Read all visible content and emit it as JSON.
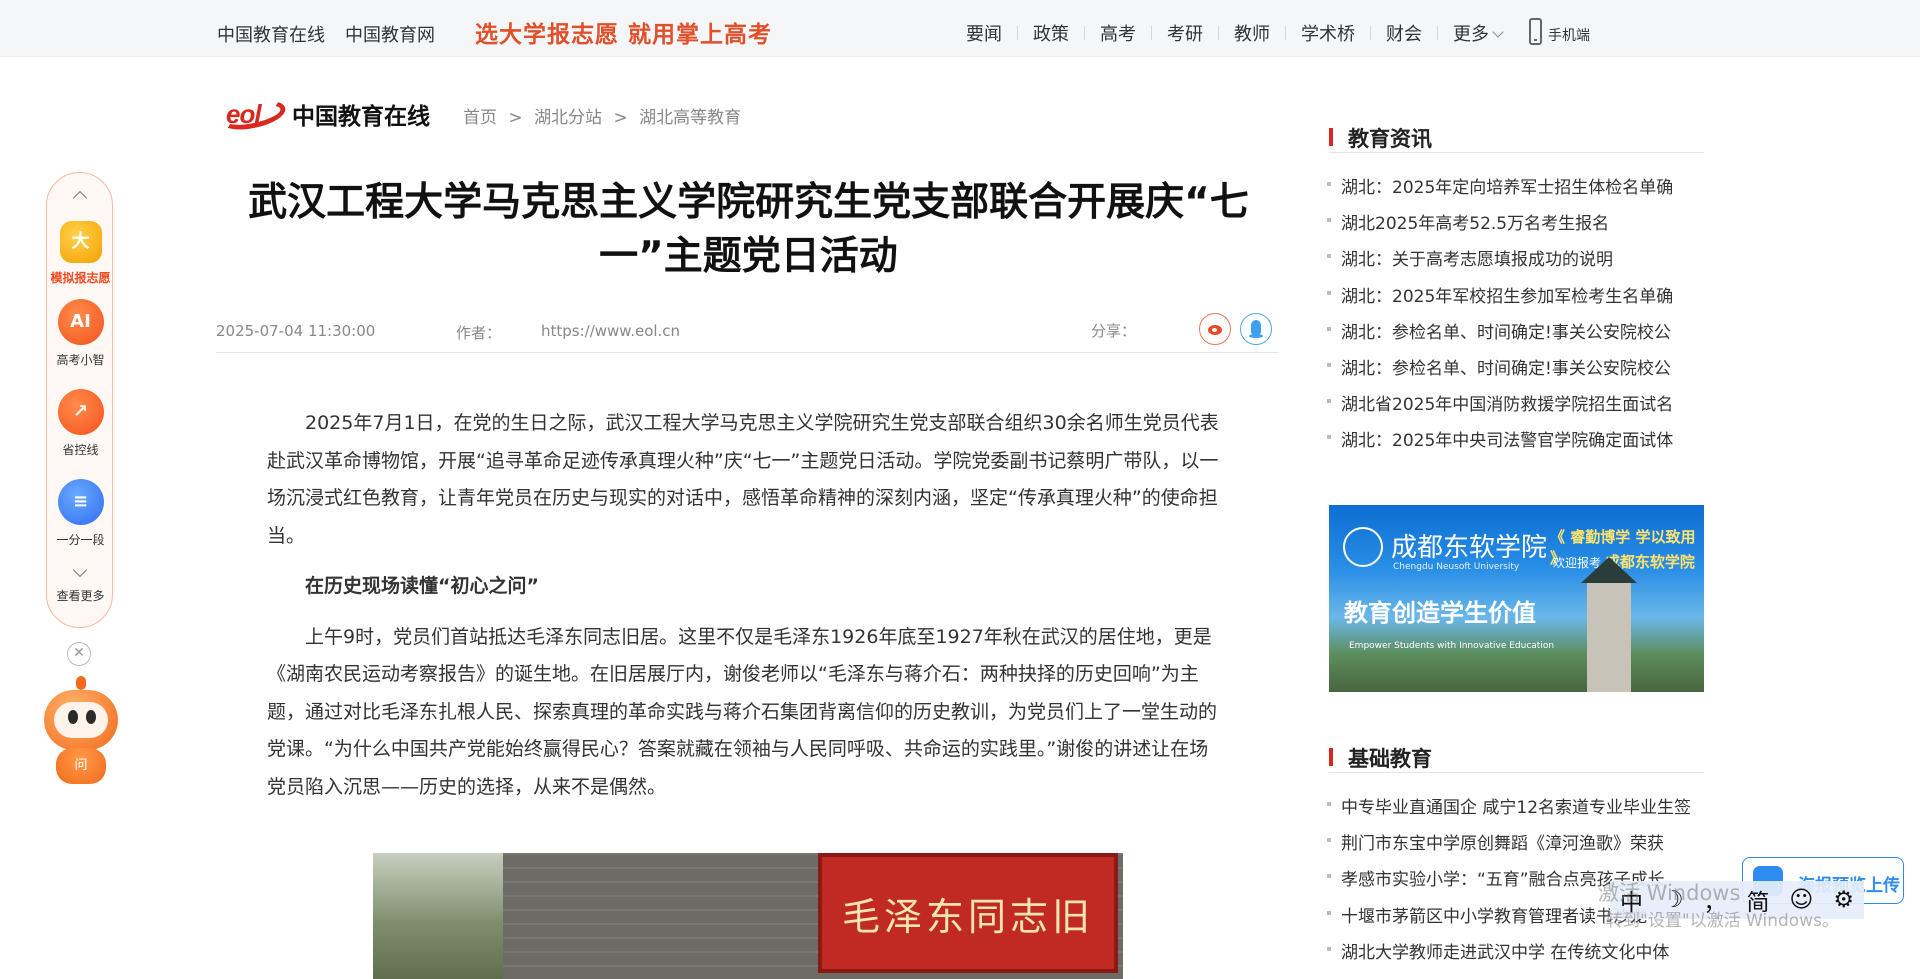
{
  "topbar": {
    "site_links": [
      "中国教育在线",
      "中国教育网"
    ],
    "slogan": "选大学报志愿 就用掌上高考",
    "nav": [
      "要闻",
      "政策",
      "高考",
      "考研",
      "教师",
      "学术桥",
      "财会"
    ],
    "more": "更多",
    "mobile": "手机端"
  },
  "header": {
    "logo_mark": "eol",
    "logo_name": "中国教育在线",
    "breadcrumb": [
      "首页",
      ">",
      "湖北分站",
      ">",
      "湖北高等教育"
    ]
  },
  "article": {
    "title": "武汉工程大学马克思主义学院研究生党支部联合开展庆“七一”主题党日活动",
    "date": "2025-07-04 11:30:00",
    "author_label": "作者：",
    "source": "https://www.eol.cn",
    "share_label": "分享：",
    "paragraphs": [
      "2025年7月1日，在党的生日之际，武汉工程大学马克思主义学院研究生党支部联合组织30余名师生党员代表赴武汉革命博物馆，开展“追寻革命足迹传承真理火种”庆“七一”主题党日活动。学院党委副书记蔡明广带队，以一场沉浸式红色教育，让青年党员在历史与现实的对话中，感悟革命精神的深刻内涵，坚定“传承真理火种”的使命担当。",
      "在历史现场读懂“初心之问”",
      "上午9时，党员们首站抵达毛泽东同志旧居。这里不仅是毛泽东1926年底至1927年秋在武汉的居住地，更是《湖南农民运动考察报告》的诞生地。在旧居展厅内，谢俊老师以“毛泽东与蒋介石：两种抉择的历史回响”为主题，通过对比毛泽东扎根人民、探索真理的革命实践与蒋介石集团背离信仰的历史教训，为党员们上了一堂生动的党课。“为什么中国共产党能始终赢得民心？答案就藏在领袖与人民同呼吸、共命运的实践里。”谢俊的讲述让在场党员陷入沉思——历史的选择，从来不是偶然。"
    ],
    "photo_sign": "毛泽东同志旧居"
  },
  "sidebar": {
    "news_title": "教育资讯",
    "news": [
      "湖北：2025年定向培养军士招生体检名单确",
      "湖北2025年高考52.5万名考生报名",
      "湖北：关于高考志愿填报成功的说明",
      "湖北：2025年军校招生参加军检考生名单确",
      "湖北：参检名单、时间确定!事关公安院校公",
      "湖北：参检名单、时间确定!事关公安院校公",
      "湖北省2025年中国消防救援学院招生面试名",
      "湖北：2025年中央司法警官学院确定面试体"
    ],
    "ad": {
      "school": "成都东软学院",
      "school_en": "Chengdu Neusoft University",
      "motto": "《 睿勤博学  学以致用 》",
      "apply": "欢迎报考",
      "apply_school": "成都东软学院",
      "slogan": "教育创造学生价值",
      "slogan_en": "Empower Students with Innovative Education"
    },
    "basic_title": "基础教育",
    "basic": [
      "中专毕业直通国企 咸宁12名索道专业毕业生签",
      "荆门市东宝中学原创舞蹈《漳河渔歌》荣获",
      "孝感市实验小学：“五育”融合点亮孩子成长",
      "十堰市茅箭区中小学教育管理者读书沙龙",
      "湖北大学教师走进武汉中学 在传统文化中体"
    ]
  },
  "float_tool": {
    "items": [
      {
        "label": "模拟报志愿",
        "glyph": "大"
      },
      {
        "label": "高考小智",
        "glyph": "AI"
      },
      {
        "label": "省控线",
        "glyph": "↗"
      },
      {
        "label": "一分一段",
        "glyph": "≡"
      }
    ],
    "more": "查看更多",
    "close": "✕",
    "robot_text": "问"
  },
  "overlays": {
    "upload": "海报预览上传",
    "ime": [
      "中",
      "☽",
      "，",
      "简",
      "☺",
      "⚙"
    ],
    "watermark": "激活 Windows",
    "watermark2": "转到\"设置\"以激活 Windows。"
  }
}
